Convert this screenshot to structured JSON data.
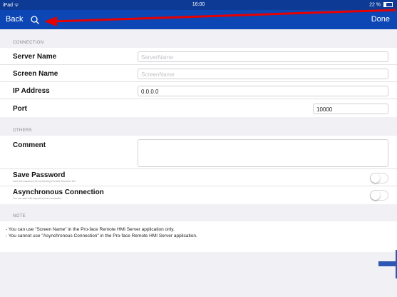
{
  "statusbar": {
    "device": "iPad ᯤ",
    "time": "16:00",
    "battery": "22 %"
  },
  "navbar": {
    "back_label": "Back",
    "done_label": "Done"
  },
  "connection": {
    "header": "CONNECTION",
    "server_name": {
      "label": "Server Name",
      "placeholder": "ServerName"
    },
    "screen_name": {
      "label": "Screen Name",
      "placeholder": "ScreenName"
    },
    "ip_address": {
      "label": "IP Address",
      "value": "0.0.0.0"
    },
    "port": {
      "label": "Port",
      "value": "10000"
    }
  },
  "others": {
    "header": "OTHERS",
    "comment": {
      "label": "Comment"
    },
    "save_password": {
      "label": "Save Password",
      "sub": "Save the password for connecting Pro-face Remote HMI"
    },
    "async_connection": {
      "label": "Asynchronous Connection",
      "sub": "You can start with asynchronous connection"
    }
  },
  "note": {
    "header": "NOTE",
    "lines": [
      "- You can use \"Screen Name\" in the Pro-face Remote HMI Server application only.",
      "- You cannot use \"Asynchronous Connection\" in the Pro-face Remote HMI Server application."
    ]
  },
  "colors": {
    "nav": "#0d47b5",
    "status": "#0c3a95",
    "annotation_arrow": "#e60000",
    "accent": "#2d57b3"
  }
}
